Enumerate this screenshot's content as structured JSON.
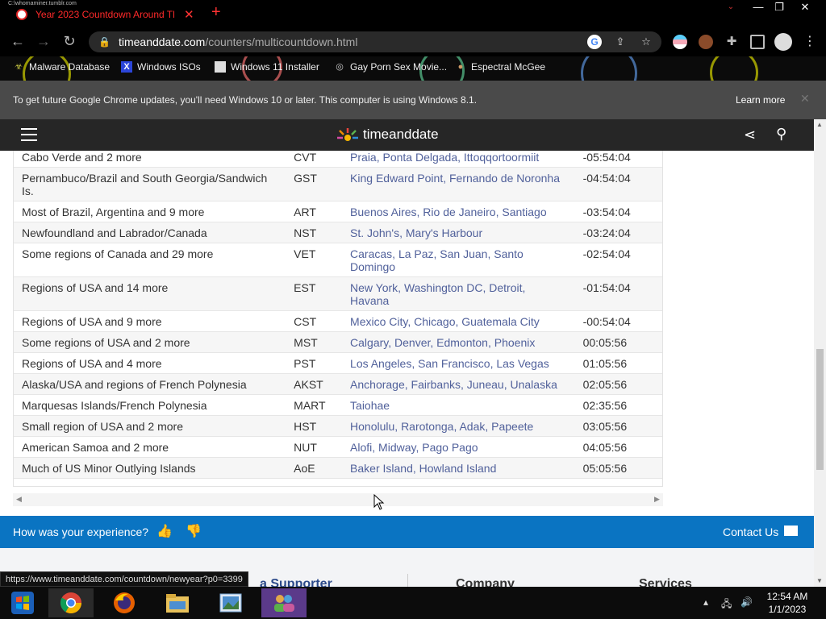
{
  "browser": {
    "tab_title": "Year 2023 Countdown Around Th",
    "tab_ghost_url": "C:\\whomaminer.tumblr.com",
    "url_host": "timeanddate.com",
    "url_path": "/counters/multicountdown.html",
    "bookmarks": [
      {
        "label": "Malware Database",
        "icon": "malware-icon"
      },
      {
        "label": "Windows ISOs",
        "icon": "x-logo-icon"
      },
      {
        "label": "Windows 11 Installer",
        "icon": "installer-icon"
      },
      {
        "label": "Gay Porn Sex Movie...",
        "icon": "site-icon"
      },
      {
        "label": "Espectral McGee",
        "icon": "site-icon"
      }
    ],
    "infobar_message": "To get future Google Chrome updates, you'll need Windows 10 or later. This computer is using Windows 8.1.",
    "infobar_link": "Learn more",
    "status_url": "https://www.timeanddate.com/countdown/newyear?p0=3399"
  },
  "site": {
    "brand": "timeanddate"
  },
  "table": {
    "rows": [
      {
        "region": "Cabo Verde and 2 more",
        "abbr": "CVT",
        "cities": "Praia, Ponta Delgada, Ittoqqortoormiit",
        "offset": "-05:54:04"
      },
      {
        "region": "Pernambuco/Brazil and South Georgia/Sandwich Is.",
        "abbr": "GST",
        "cities": "King Edward Point, Fernando de Noronha",
        "offset": "-04:54:04"
      },
      {
        "region": "Most of Brazil, Argentina and 9 more",
        "abbr": "ART",
        "cities": "Buenos Aires, Rio de Janeiro, Santiago",
        "offset": "-03:54:04"
      },
      {
        "region": "Newfoundland and Labrador/Canada",
        "abbr": "NST",
        "cities": "St. John's, Mary's Harbour",
        "offset": "-03:24:04"
      },
      {
        "region": "Some regions of Canada and 29 more",
        "abbr": "VET",
        "cities": "Caracas, La Paz, San Juan, Santo Domingo",
        "offset": "-02:54:04"
      },
      {
        "region": "Regions of USA and 14 more",
        "abbr": "EST",
        "cities": "New York, Washington DC, Detroit, Havana",
        "offset": "-01:54:04"
      },
      {
        "region": "Regions of USA and 9 more",
        "abbr": "CST",
        "cities": "Mexico City, Chicago, Guatemala City",
        "offset": "-00:54:04"
      },
      {
        "region": "Some regions of USA and 2 more",
        "abbr": "MST",
        "cities": "Calgary, Denver, Edmonton, Phoenix",
        "offset": "00:05:56"
      },
      {
        "region": "Regions of USA and 4 more",
        "abbr": "PST",
        "cities": "Los Angeles, San Francisco, Las Vegas",
        "offset": "01:05:56"
      },
      {
        "region": "Alaska/USA and regions of French Polynesia",
        "abbr": "AKST",
        "cities": "Anchorage, Fairbanks, Juneau, Unalaska",
        "offset": "02:05:56"
      },
      {
        "region": "Marquesas Islands/French Polynesia",
        "abbr": "MART",
        "cities": "Taiohae",
        "offset": "02:35:56"
      },
      {
        "region": "Small region of USA and 2 more",
        "abbr": "HST",
        "cities": "Honolulu, Rarotonga, Adak, Papeete",
        "offset": "03:05:56"
      },
      {
        "region": "American Samoa and 2 more",
        "abbr": "NUT",
        "cities": "Alofi, Midway, Pago Pago",
        "offset": "04:05:56"
      },
      {
        "region": "Much of US Minor Outlying Islands",
        "abbr": "AoE",
        "cities": "Baker Island, Howland Island",
        "offset": "05:05:56"
      }
    ]
  },
  "feedback": {
    "question": "How was your experience?",
    "contact": "Contact Us"
  },
  "footer": {
    "col1_partial": "a Supporter",
    "col2": "Company",
    "col3": "Services"
  },
  "taskbar": {
    "time": "12:54 AM",
    "date": "1/1/2023"
  },
  "colors": {
    "feedback_bar": "#0a74c2",
    "link": "#51619b",
    "tab_text": "#ff2a2a"
  }
}
